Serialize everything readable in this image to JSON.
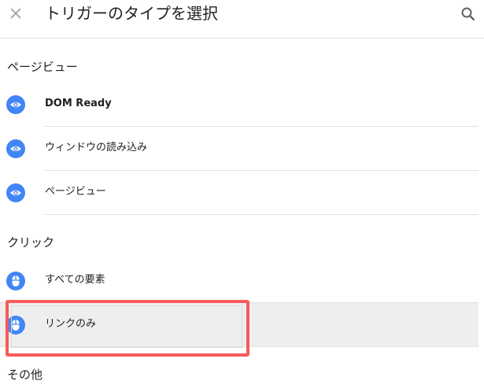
{
  "header": {
    "title": "トリガーのタイプを選択",
    "close_icon": "close-icon",
    "search_icon": "search-icon"
  },
  "sections": [
    {
      "title": "ページビュー",
      "items": [
        {
          "label": "DOM Ready",
          "icon": "eye-icon"
        },
        {
          "label": "ウィンドウの読み込み",
          "icon": "eye-icon"
        },
        {
          "label": "ページビュー",
          "icon": "eye-icon"
        }
      ]
    },
    {
      "title": "クリック",
      "items": [
        {
          "label": "すべての要素",
          "icon": "mouse-icon"
        },
        {
          "label": "リンクのみ",
          "icon": "mouse-icon",
          "selected": true
        }
      ]
    },
    {
      "title": "その他",
      "items": []
    }
  ],
  "colors": {
    "accent": "#4285f4",
    "highlight_border": "#f75a5a",
    "selected_background": "#eeeeee",
    "divider": "#e0e0e0"
  }
}
